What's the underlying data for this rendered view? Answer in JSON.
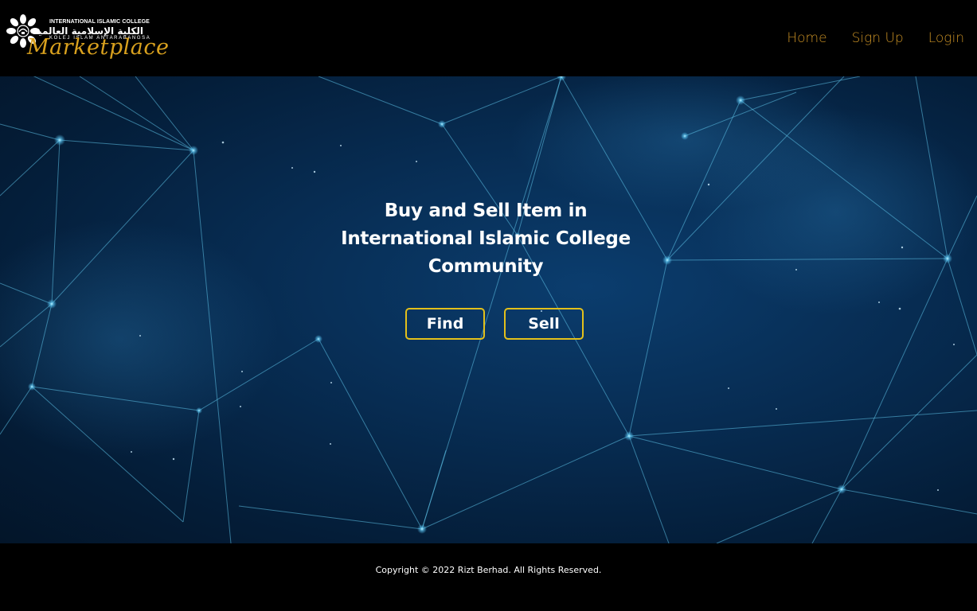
{
  "header": {
    "logo": {
      "line1": "INTERNATIONAL ISLAMIC COLLEGE",
      "arabic": "الكلية الإسلامية العالمية",
      "line3": "KOLEJ ISLAM ANTARABANGSA",
      "script": "Marketplace"
    },
    "nav": {
      "home": "Home",
      "signup": "Sign Up",
      "login": "Login"
    }
  },
  "hero": {
    "title_line1": "Buy and Sell Item in",
    "title_line2": "International Islamic College",
    "title_line3": "Community",
    "find_label": "Find",
    "sell_label": "Sell"
  },
  "footer": {
    "copyright": "Copyright © 2022 Rizt Berhad. All Rights Reserved."
  },
  "colors": {
    "nav_link": "#c78f24",
    "button_border": "#e3c01b",
    "logo_script": "#d9a11e",
    "network_line": "#5fc3e8"
  },
  "icons": {
    "logo_seal": "college-seal-icon"
  }
}
